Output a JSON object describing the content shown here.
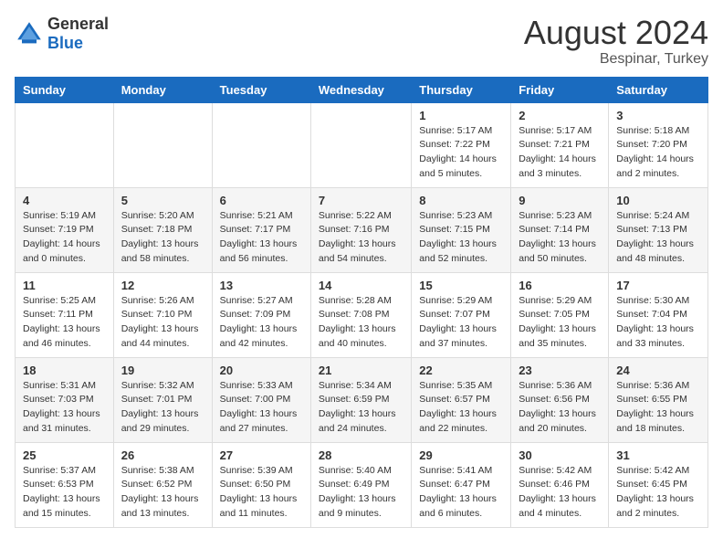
{
  "header": {
    "logo": {
      "text_general": "General",
      "text_blue": "Blue"
    },
    "title": "August 2024",
    "location": "Bespinar, Turkey"
  },
  "calendar": {
    "days_of_week": [
      "Sunday",
      "Monday",
      "Tuesday",
      "Wednesday",
      "Thursday",
      "Friday",
      "Saturday"
    ],
    "weeks": [
      [
        {
          "day": "",
          "info": ""
        },
        {
          "day": "",
          "info": ""
        },
        {
          "day": "",
          "info": ""
        },
        {
          "day": "",
          "info": ""
        },
        {
          "day": "1",
          "info": "Sunrise: 5:17 AM\nSunset: 7:22 PM\nDaylight: 14 hours\nand 5 minutes."
        },
        {
          "day": "2",
          "info": "Sunrise: 5:17 AM\nSunset: 7:21 PM\nDaylight: 14 hours\nand 3 minutes."
        },
        {
          "day": "3",
          "info": "Sunrise: 5:18 AM\nSunset: 7:20 PM\nDaylight: 14 hours\nand 2 minutes."
        }
      ],
      [
        {
          "day": "4",
          "info": "Sunrise: 5:19 AM\nSunset: 7:19 PM\nDaylight: 14 hours\nand 0 minutes."
        },
        {
          "day": "5",
          "info": "Sunrise: 5:20 AM\nSunset: 7:18 PM\nDaylight: 13 hours\nand 58 minutes."
        },
        {
          "day": "6",
          "info": "Sunrise: 5:21 AM\nSunset: 7:17 PM\nDaylight: 13 hours\nand 56 minutes."
        },
        {
          "day": "7",
          "info": "Sunrise: 5:22 AM\nSunset: 7:16 PM\nDaylight: 13 hours\nand 54 minutes."
        },
        {
          "day": "8",
          "info": "Sunrise: 5:23 AM\nSunset: 7:15 PM\nDaylight: 13 hours\nand 52 minutes."
        },
        {
          "day": "9",
          "info": "Sunrise: 5:23 AM\nSunset: 7:14 PM\nDaylight: 13 hours\nand 50 minutes."
        },
        {
          "day": "10",
          "info": "Sunrise: 5:24 AM\nSunset: 7:13 PM\nDaylight: 13 hours\nand 48 minutes."
        }
      ],
      [
        {
          "day": "11",
          "info": "Sunrise: 5:25 AM\nSunset: 7:11 PM\nDaylight: 13 hours\nand 46 minutes."
        },
        {
          "day": "12",
          "info": "Sunrise: 5:26 AM\nSunset: 7:10 PM\nDaylight: 13 hours\nand 44 minutes."
        },
        {
          "day": "13",
          "info": "Sunrise: 5:27 AM\nSunset: 7:09 PM\nDaylight: 13 hours\nand 42 minutes."
        },
        {
          "day": "14",
          "info": "Sunrise: 5:28 AM\nSunset: 7:08 PM\nDaylight: 13 hours\nand 40 minutes."
        },
        {
          "day": "15",
          "info": "Sunrise: 5:29 AM\nSunset: 7:07 PM\nDaylight: 13 hours\nand 37 minutes."
        },
        {
          "day": "16",
          "info": "Sunrise: 5:29 AM\nSunset: 7:05 PM\nDaylight: 13 hours\nand 35 minutes."
        },
        {
          "day": "17",
          "info": "Sunrise: 5:30 AM\nSunset: 7:04 PM\nDaylight: 13 hours\nand 33 minutes."
        }
      ],
      [
        {
          "day": "18",
          "info": "Sunrise: 5:31 AM\nSunset: 7:03 PM\nDaylight: 13 hours\nand 31 minutes."
        },
        {
          "day": "19",
          "info": "Sunrise: 5:32 AM\nSunset: 7:01 PM\nDaylight: 13 hours\nand 29 minutes."
        },
        {
          "day": "20",
          "info": "Sunrise: 5:33 AM\nSunset: 7:00 PM\nDaylight: 13 hours\nand 27 minutes."
        },
        {
          "day": "21",
          "info": "Sunrise: 5:34 AM\nSunset: 6:59 PM\nDaylight: 13 hours\nand 24 minutes."
        },
        {
          "day": "22",
          "info": "Sunrise: 5:35 AM\nSunset: 6:57 PM\nDaylight: 13 hours\nand 22 minutes."
        },
        {
          "day": "23",
          "info": "Sunrise: 5:36 AM\nSunset: 6:56 PM\nDaylight: 13 hours\nand 20 minutes."
        },
        {
          "day": "24",
          "info": "Sunrise: 5:36 AM\nSunset: 6:55 PM\nDaylight: 13 hours\nand 18 minutes."
        }
      ],
      [
        {
          "day": "25",
          "info": "Sunrise: 5:37 AM\nSunset: 6:53 PM\nDaylight: 13 hours\nand 15 minutes."
        },
        {
          "day": "26",
          "info": "Sunrise: 5:38 AM\nSunset: 6:52 PM\nDaylight: 13 hours\nand 13 minutes."
        },
        {
          "day": "27",
          "info": "Sunrise: 5:39 AM\nSunset: 6:50 PM\nDaylight: 13 hours\nand 11 minutes."
        },
        {
          "day": "28",
          "info": "Sunrise: 5:40 AM\nSunset: 6:49 PM\nDaylight: 13 hours\nand 9 minutes."
        },
        {
          "day": "29",
          "info": "Sunrise: 5:41 AM\nSunset: 6:47 PM\nDaylight: 13 hours\nand 6 minutes."
        },
        {
          "day": "30",
          "info": "Sunrise: 5:42 AM\nSunset: 6:46 PM\nDaylight: 13 hours\nand 4 minutes."
        },
        {
          "day": "31",
          "info": "Sunrise: 5:42 AM\nSunset: 6:45 PM\nDaylight: 13 hours\nand 2 minutes."
        }
      ]
    ]
  }
}
